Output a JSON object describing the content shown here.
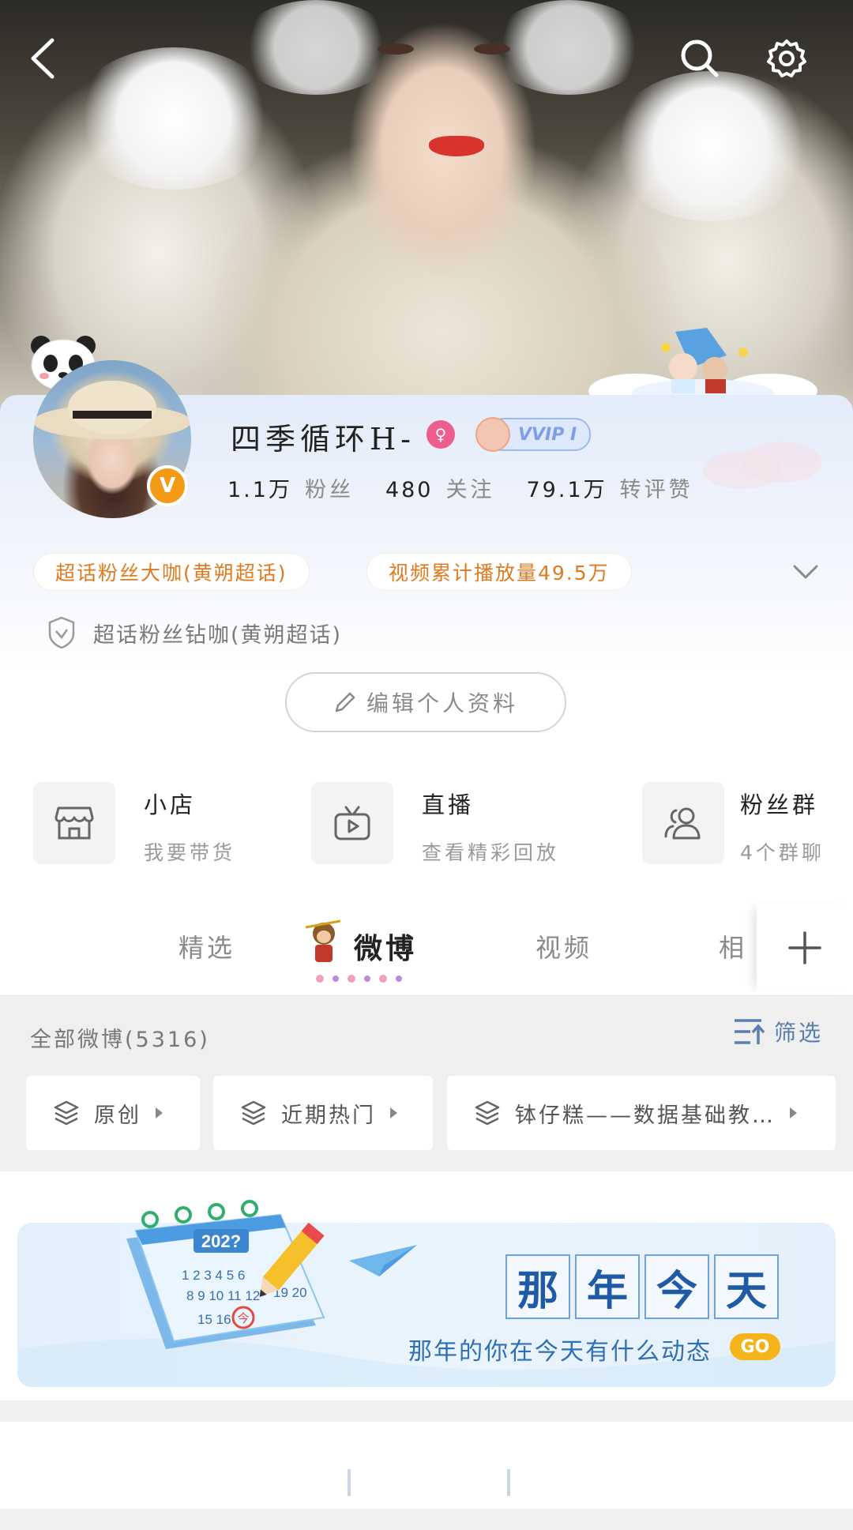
{
  "header": {
    "back_icon": "back-arrow-icon",
    "search_icon": "search-icon",
    "settings_icon": "gear-icon"
  },
  "profile": {
    "name": "四季循环H-",
    "gender_symbol": "♀",
    "vip_label": "VVIP I",
    "verified_badge": "V",
    "stats": [
      {
        "value": "1.1万",
        "label": "粉丝"
      },
      {
        "value": "480",
        "label": "关注"
      },
      {
        "value": "79.1万",
        "label": "转评赞"
      }
    ],
    "chips": [
      "超话粉丝大咖(黄朔超话)",
      "视频累计播放量49.5万"
    ],
    "honor": "超话粉丝钻咖(黄朔超话)",
    "edit_button": "编辑个人资料"
  },
  "features": [
    {
      "title": "小店",
      "subtitle": "我要带货",
      "icon": "shop-icon"
    },
    {
      "title": "直播",
      "subtitle": "查看精彩回放",
      "icon": "tv-icon"
    },
    {
      "title": "粉丝群",
      "subtitle": "4个群聊",
      "icon": "group-icon"
    }
  ],
  "tabs": {
    "items": [
      "精选",
      "微博",
      "视频",
      "相"
    ],
    "active": "微博",
    "add_icon": "plus-icon"
  },
  "feed": {
    "all_count": "全部微博(5316)",
    "filter_label": "筛选",
    "filter_chips": [
      "原创",
      "近期热门",
      "钵仔糕——数据基础教…"
    ]
  },
  "banner": {
    "calendar_year": "202?",
    "calendar_dates": "1 2 3 4 5 6",
    "calendar_dates2": "8 9 10 11 12",
    "calendar_dates3": "15 16",
    "calendar_dates4": "19 20",
    "today_mark": "今",
    "title_chars": [
      "那",
      "年",
      "今",
      "天"
    ],
    "slogan": "那年的你在今天有什么动态",
    "go_label": "GO"
  },
  "colors": {
    "accent_orange": "#f39a17",
    "chip_text": "#e07a1f",
    "link_blue": "#5a7db0",
    "banner_blue": "#1f5aa6"
  }
}
